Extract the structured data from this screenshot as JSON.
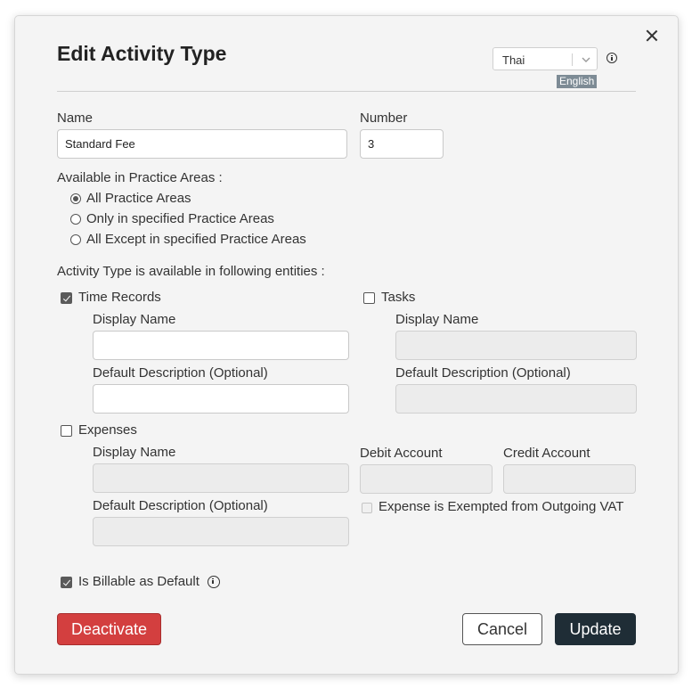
{
  "dialog": {
    "title": "Edit Activity Type",
    "language_select_value": "Thai",
    "language_tag": "English"
  },
  "name": {
    "label": "Name",
    "value": "Standard Fee"
  },
  "number": {
    "label": "Number",
    "value": "3"
  },
  "practice_areas": {
    "label": "Available in Practice Areas :",
    "options": [
      {
        "label": "All Practice Areas",
        "selected": true
      },
      {
        "label": "Only in specified Practice Areas",
        "selected": false
      },
      {
        "label": "All Except in specified Practice Areas",
        "selected": false
      }
    ]
  },
  "entities": {
    "label": "Activity Type is available in following entities :",
    "time_records": {
      "label": "Time Records",
      "checked": true,
      "display_name_label": "Display Name",
      "display_name_value": "",
      "default_desc_label": "Default Description (Optional)",
      "default_desc_value": ""
    },
    "tasks": {
      "label": "Tasks",
      "checked": false,
      "display_name_label": "Display Name",
      "default_desc_label": "Default Description (Optional)"
    },
    "expenses": {
      "label": "Expenses",
      "checked": false,
      "display_name_label": "Display Name",
      "default_desc_label": "Default Description (Optional)",
      "debit_account_label": "Debit Account",
      "credit_account_label": "Credit Account",
      "vat_exempt_label": "Expense is Exempted from Outgoing VAT"
    }
  },
  "billable": {
    "label": "Is Billable as Default",
    "checked": true
  },
  "buttons": {
    "deactivate": "Deactivate",
    "cancel": "Cancel",
    "update": "Update"
  },
  "colors": {
    "danger": "#d33f3f",
    "primary_dark": "#1f2d36",
    "tag_bg": "#7d8b95"
  }
}
